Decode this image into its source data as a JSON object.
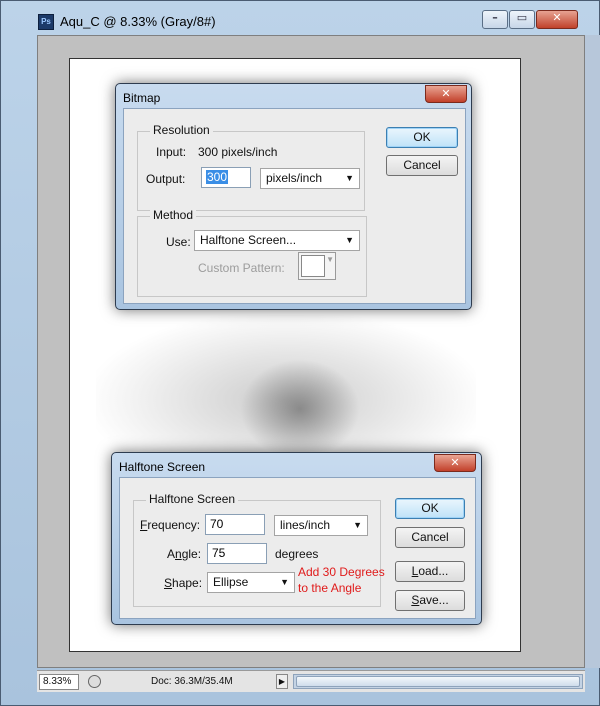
{
  "window": {
    "title": "Aqu_C @ 8.33% (Gray/8#)",
    "app_icon": "Ps"
  },
  "status": {
    "zoom": "8.33%",
    "doc_info": "Doc: 36.3M/35.4M"
  },
  "bitmap_dialog": {
    "title": "Bitmap",
    "close": "x",
    "resolution_group": "Resolution",
    "input_label": "Input:",
    "input_value": "300 pixels/inch",
    "output_label": "Output:",
    "output_value": "300",
    "output_unit": "pixels/inch",
    "method_group": "Method",
    "use_label": "Use:",
    "use_value": "Halftone Screen...",
    "custom_pattern_label": "Custom Pattern:",
    "ok": "OK",
    "cancel": "Cancel"
  },
  "halftone_dialog": {
    "title": "Halftone Screen",
    "close": "x",
    "group": "Halftone Screen",
    "frequency_label_u": "F",
    "frequency_label_rest": "requency:",
    "frequency_value": "70",
    "frequency_unit": "lines/inch",
    "angle_label_pre": "A",
    "angle_label_u": "n",
    "angle_label_rest": "gle:",
    "angle_value": "75",
    "angle_unit": "degrees",
    "shape_label_u": "S",
    "shape_label_rest": "hape:",
    "shape_value": "Ellipse",
    "ok": "OK",
    "cancel": "Cancel",
    "load_u": "L",
    "load_rest": "oad...",
    "save_u": "S",
    "save_rest": "ave...",
    "note_line1": "Add 30 Degrees",
    "note_line2": "to the Angle"
  },
  "colors": {
    "note": "#e01b1b",
    "selection": "#3a8ee6",
    "titlebar": "#bcd3e9"
  }
}
